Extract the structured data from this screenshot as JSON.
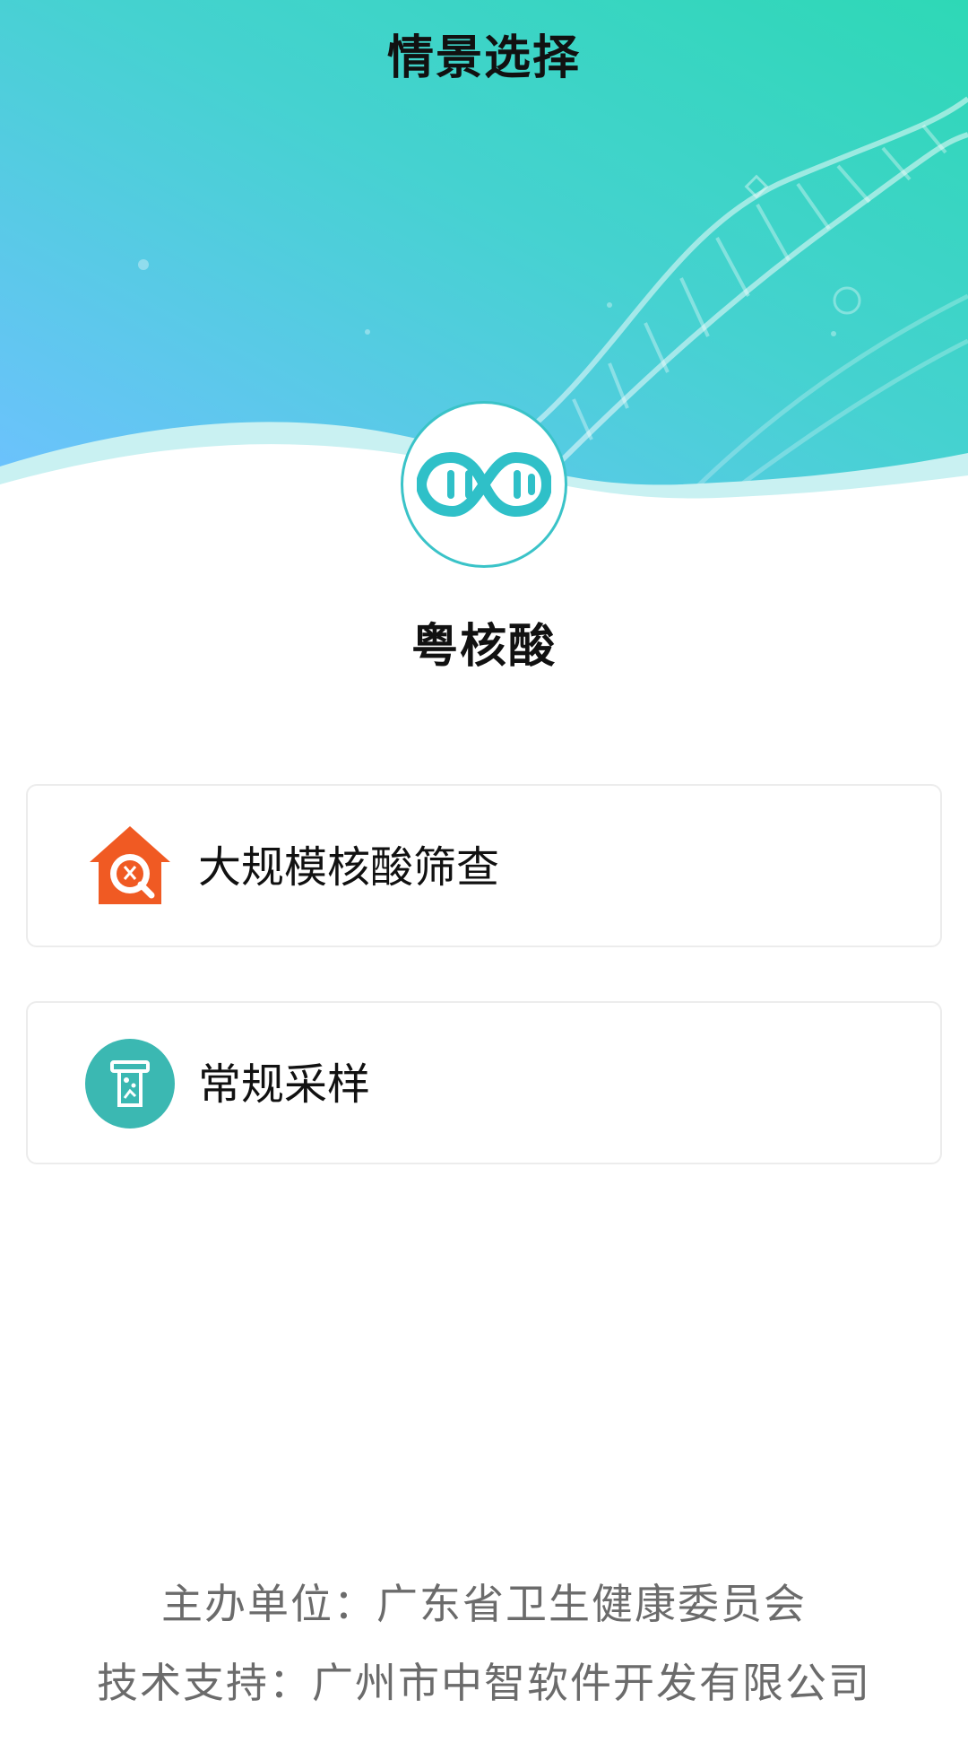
{
  "header": {
    "title": "情景选择"
  },
  "app": {
    "name": "粤核酸"
  },
  "options": [
    {
      "label": "大规模核酸筛查",
      "icon": "house-search-icon",
      "color": "#f05a23"
    },
    {
      "label": "常规采样",
      "icon": "test-tube-icon",
      "color": "#3bb8b2"
    }
  ],
  "footer": {
    "organizer": "主办单位：广东省卫生健康委员会",
    "support": "技术支持：广州市中智软件开发有限公司"
  },
  "colors": {
    "gradient_start": "#6ec1ff",
    "gradient_end": "#2ed8b6",
    "accent": "#3ac3c8"
  }
}
